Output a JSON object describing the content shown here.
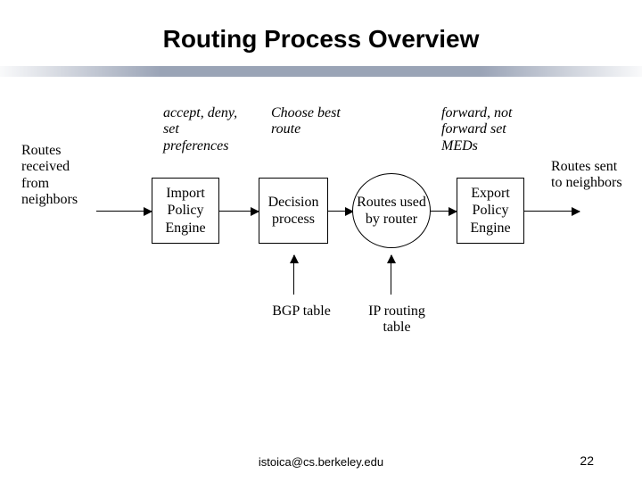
{
  "title": "Routing Process Overview",
  "annotations": {
    "import": "accept, deny, set preferences",
    "decision": "Choose best route",
    "export": "forward, not forward set MEDs"
  },
  "side_labels": {
    "left": "Routes received from neighbors",
    "right": "Routes sent to neighbors"
  },
  "boxes": {
    "import": "Import Policy Engine",
    "decision": "Decision process",
    "export": "Export Policy Engine"
  },
  "ellipse": "Routes used by router",
  "bottom_labels": {
    "bgp": "BGP table",
    "ip": "IP routing table"
  },
  "footer": {
    "email": "istoica@cs.berkeley.edu",
    "page": "22"
  }
}
